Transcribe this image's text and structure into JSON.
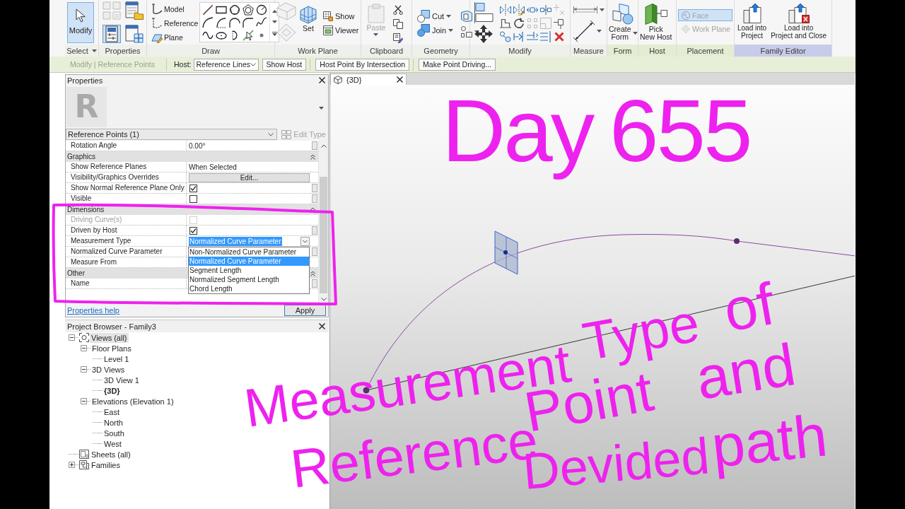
{
  "ribbon": {
    "panels": [
      {
        "label": "Select",
        "dropdown": true,
        "color": "#eef0ec",
        "buttons": [
          {
            "label": "Modify",
            "selected": true,
            "disabled": false
          }
        ]
      },
      {
        "label": "Properties",
        "color": "#eef0ec",
        "buttons": [
          {
            "selected": false
          },
          {
            "selected": false
          },
          {
            "selected": true
          },
          {
            "selected": false
          }
        ]
      },
      {
        "label": "Draw",
        "color": "#eef0ec",
        "buttons": [
          {
            "label": "Model",
            "disabled": false
          },
          {
            "label": "Reference",
            "disabled": false
          },
          {
            "label": "Plane",
            "disabled": false
          }
        ]
      },
      {
        "label": "Work Plane",
        "color": "#eef0ec",
        "buttons": [
          {
            "label": "Set",
            "disabled": false
          },
          {
            "label": "Show",
            "disabled": false
          },
          {
            "label": "Viewer",
            "disabled": false
          }
        ]
      },
      {
        "label": "Clipboard",
        "color": "#eef0ec",
        "buttons": [
          {
            "label": "Paste",
            "disabled": true,
            "dropdown": true
          }
        ]
      },
      {
        "label": "Geometry",
        "color": "#eef0ec",
        "buttons": [
          {
            "label": "Cut",
            "disabled": false,
            "dropdown": true
          },
          {
            "label": "Join",
            "disabled": false,
            "dropdown": true
          }
        ]
      },
      {
        "label": "Modify",
        "color": "#eef0ec"
      },
      {
        "label": "Measure",
        "color": "#eef0ec"
      },
      {
        "label": "Form",
        "color": "#e4ecd4",
        "buttons": [
          {
            "label": "Create\nForm",
            "disabled": false,
            "dropdown": true
          }
        ]
      },
      {
        "label": "Host",
        "color": "#e4ecd4",
        "buttons": [
          {
            "label": "Pick\nNew Host",
            "disabled": false
          }
        ]
      },
      {
        "label": "Placement",
        "color": "#e4ecd4",
        "buttons": [
          {
            "label": "Face",
            "selected": true,
            "disabled": true
          },
          {
            "label": "Work Plane",
            "selected": false,
            "disabled": true
          }
        ]
      },
      {
        "label": "Family Editor",
        "color": "#c8cbe9",
        "buttons": [
          {
            "label": "Load into\nProject",
            "disabled": false
          },
          {
            "label": "Load into\nProject and Close",
            "disabled": false
          }
        ]
      }
    ]
  },
  "options_bar": {
    "context": "Modify | Reference Points",
    "host_label": "Host:",
    "host_value": "Reference Lines",
    "buttons": [
      "Show Host",
      "Host Point By Intersection",
      "Make Point Driving..."
    ]
  },
  "properties": {
    "title": "Properties",
    "logo_text": "R",
    "type_selector": "Reference Points (1)",
    "edit_type": {
      "label": "Edit Type",
      "disabled": true
    },
    "rows": [
      {
        "kind": "param",
        "name": "Rotation Angle",
        "value": "0.00°",
        "associate_button": true
      },
      {
        "kind": "group",
        "name": "Graphics",
        "expanded": true
      },
      {
        "kind": "param",
        "name": "Show Reference Planes",
        "value": "When Selected",
        "associate_button": false
      },
      {
        "kind": "button",
        "name": "Visibility/Graphics Overrides",
        "value": "Edit...",
        "associate_button": false
      },
      {
        "kind": "checkbox",
        "name": "Show Normal Reference Plane Only",
        "checked": true,
        "disabled": false,
        "associate_button": true
      },
      {
        "kind": "checkbox",
        "name": "Visible",
        "checked": false,
        "disabled": false,
        "associate_button": true
      },
      {
        "kind": "group",
        "name": "Dimensions",
        "expanded": true
      },
      {
        "kind": "checkbox",
        "name": "Driving Curve(s)",
        "checked": false,
        "disabled": true,
        "associate_button": false
      },
      {
        "kind": "checkbox",
        "name": "Driven by Host",
        "checked": true,
        "disabled": false,
        "associate_button": true
      },
      {
        "kind": "dropdown",
        "name": "Measurement Type",
        "value": "Normalized Curve Parameter",
        "open": true,
        "associate_button": false,
        "options": [
          {
            "label": "Non-Normalized Curve Parameter",
            "selected": false
          },
          {
            "label": "Normalized Curve Parameter",
            "selected": true
          },
          {
            "label": "Segment Length",
            "selected": false
          },
          {
            "label": "Normalized Segment Length",
            "selected": false
          },
          {
            "label": "Chord Length",
            "selected": false
          }
        ]
      },
      {
        "kind": "param",
        "name": "Normalized Curve Parameter",
        "associate_button": true
      },
      {
        "kind": "param",
        "name": "Measure From",
        "associate_button": false
      },
      {
        "kind": "group",
        "name": "Other",
        "expanded": true
      },
      {
        "kind": "param",
        "name": "Name",
        "associate_button": true
      }
    ],
    "help_link": "Properties help",
    "apply": "Apply"
  },
  "project_browser": {
    "title": "Project Browser - Family3",
    "tree": [
      {
        "kind": "views",
        "label": "Views (all)",
        "expanded": true,
        "selected": true,
        "children": [
          {
            "label": "Floor Plans",
            "expanded": true,
            "selected": false,
            "children": [
              {
                "label": "Level 1",
                "selected": false
              }
            ]
          },
          {
            "label": "3D Views",
            "expanded": true,
            "selected": false,
            "children": [
              {
                "label": "3D View 1",
                "selected": false,
                "active": false
              },
              {
                "label": "{3D}",
                "selected": false,
                "active": true
              }
            ]
          },
          {
            "label": "Elevations (Elevation 1)",
            "expanded": true,
            "selected": false,
            "children": [
              {
                "label": "East",
                "selected": false
              },
              {
                "label": "North",
                "selected": false
              },
              {
                "label": "South",
                "selected": false
              },
              {
                "label": "West",
                "selected": false
              }
            ]
          }
        ]
      },
      {
        "kind": "sheets",
        "label": "Sheets (all)",
        "selected": false
      },
      {
        "kind": "families",
        "label": "Families",
        "expanded": false,
        "selected": false
      }
    ]
  },
  "view": {
    "tab": "{3D}"
  },
  "annotations": [
    {
      "words": [
        "Day",
        "655"
      ]
    },
    {
      "words": [
        "Measurement",
        "Type",
        "of"
      ]
    },
    {
      "words": [
        "Reference",
        "Point",
        "and"
      ]
    },
    {
      "words": [
        "Devided",
        "path"
      ]
    }
  ]
}
